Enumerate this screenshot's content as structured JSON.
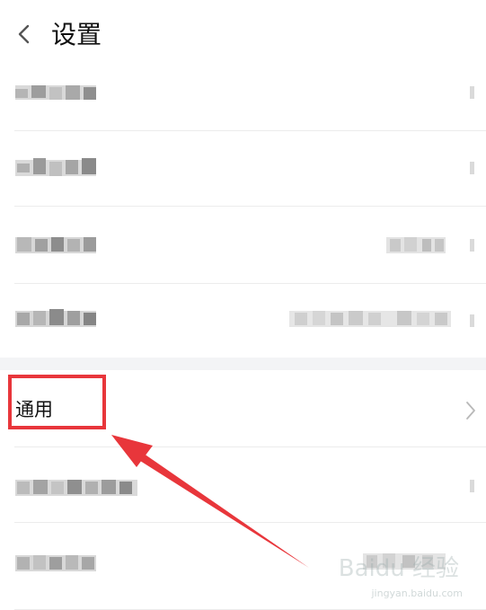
{
  "header": {
    "title": "设置"
  },
  "general_item": {
    "label": "通用"
  },
  "watermark": {
    "brand": "Baidu 经验",
    "sub": "jingyan.baidu.com"
  }
}
